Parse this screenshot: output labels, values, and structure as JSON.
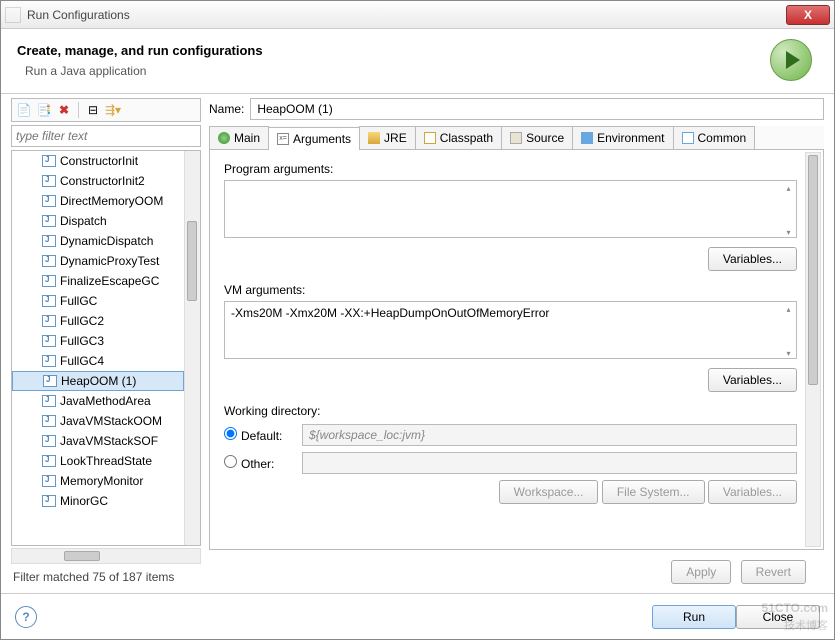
{
  "window": {
    "title": "Run Configurations",
    "close": "X"
  },
  "header": {
    "title": "Create, manage, and run configurations",
    "subtitle": "Run a Java application"
  },
  "left": {
    "filter_placeholder": "type filter text",
    "items": [
      "ConstructorInit",
      "ConstructorInit2",
      "DirectMemoryOOM",
      "Dispatch",
      "DynamicDispatch",
      "DynamicProxyTest",
      "FinalizeEscapeGC",
      "FullGC",
      "FullGC2",
      "FullGC3",
      "FullGC4",
      "HeapOOM (1)",
      "JavaMethodArea",
      "JavaVMStackOOM",
      "JavaVMStackSOF",
      "LookThreadState",
      "MemoryMonitor",
      "MinorGC"
    ],
    "selected_index": 11,
    "status": "Filter matched 75 of 187 items"
  },
  "right": {
    "name_label": "Name:",
    "name_value": "HeapOOM (1)",
    "tabs": [
      "Main",
      "Arguments",
      "JRE",
      "Classpath",
      "Source",
      "Environment",
      "Common"
    ],
    "active_tab": 1,
    "program_args_label": "Program arguments:",
    "program_args": "",
    "vm_args_label": "VM arguments:",
    "vm_args": "-Xms20M -Xmx20M -XX:+HeapDumpOnOutOfMemoryError",
    "variables_btn": "Variables...",
    "working_dir_label": "Working directory:",
    "default_label": "Default:",
    "other_label": "Other:",
    "default_value": "${workspace_loc:jvm}",
    "workspace_btn": "Workspace...",
    "filesystem_btn": "File System...",
    "apply": "Apply",
    "revert": "Revert"
  },
  "footer": {
    "run": "Run",
    "close": "Close",
    "help": "?"
  },
  "watermark": {
    "site": "51CTO.com",
    "tag": "技术博客"
  }
}
